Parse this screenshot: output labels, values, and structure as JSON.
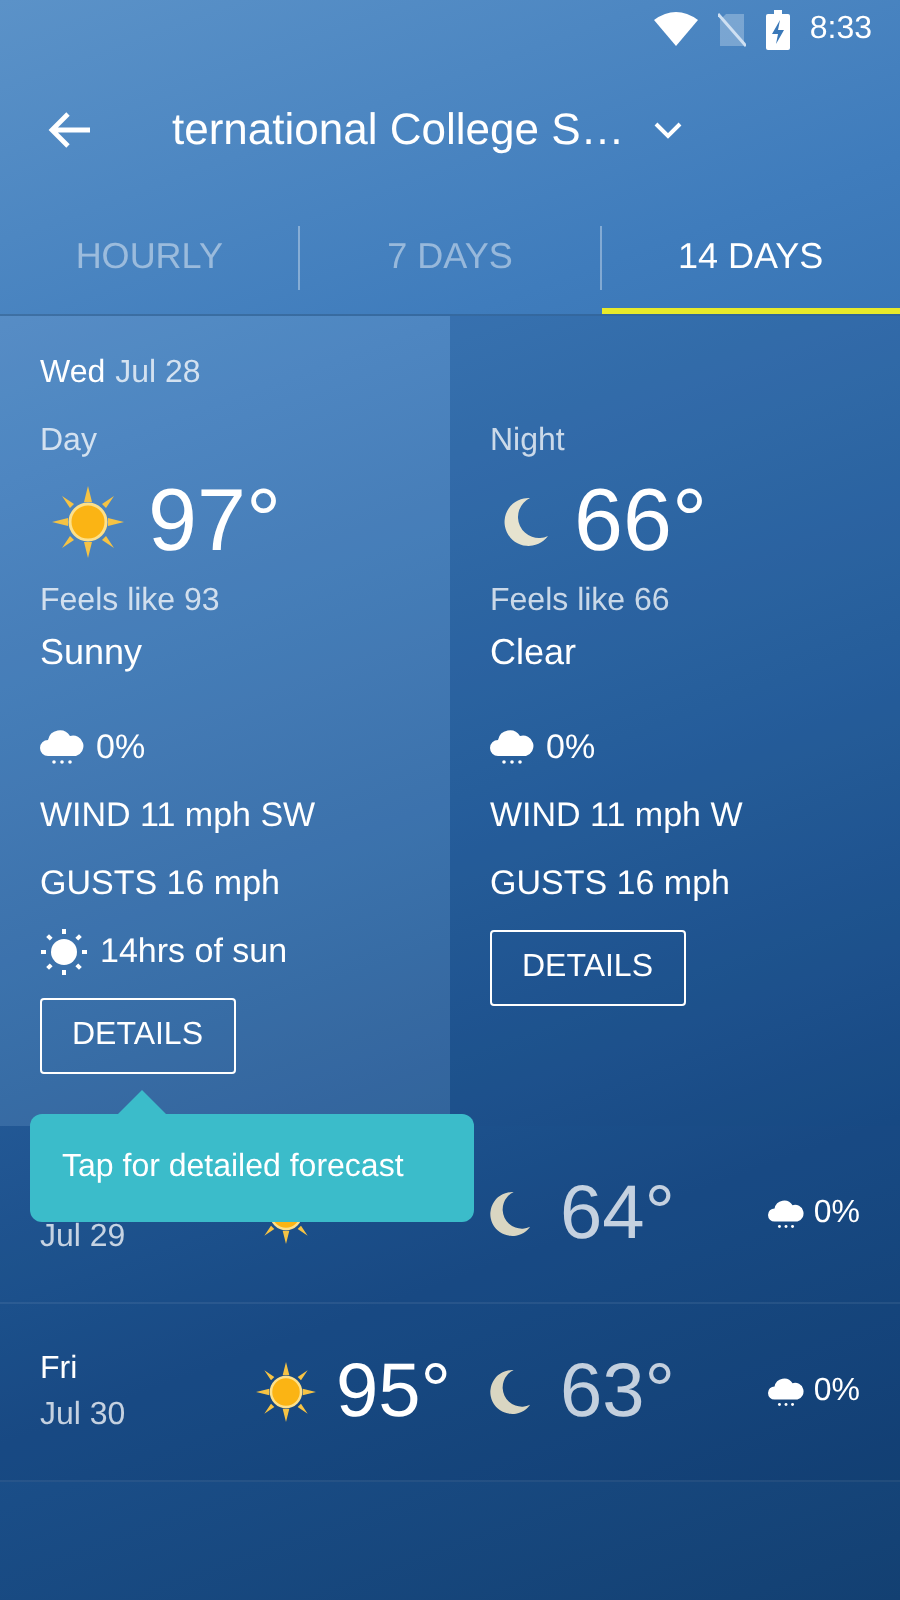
{
  "status_bar": {
    "time": "8:33"
  },
  "header": {
    "title": "ternational College S…"
  },
  "tabs": [
    {
      "label": "HOURLY",
      "selected": false
    },
    {
      "label": "7 DAYS",
      "selected": false
    },
    {
      "label": "14 DAYS",
      "selected": true
    }
  ],
  "detail": {
    "weekday": "Wed",
    "date": "Jul 28",
    "panes": [
      {
        "kind": "day",
        "label": "Day",
        "temp": "97°",
        "feels_like": "Feels like 93",
        "condition": "Sunny",
        "precip": "0%",
        "wind": "WIND 11 mph SW",
        "gusts": "GUSTS 16 mph",
        "sun": "14hrs of sun",
        "button": "DETAILS"
      },
      {
        "kind": "night",
        "label": "Night",
        "temp": "66°",
        "feels_like": "Feels like 66",
        "condition": "Clear",
        "precip": "0%",
        "wind": "WIND 11 mph W",
        "gusts": "GUSTS 16 mph",
        "button": "DETAILS"
      }
    ]
  },
  "tooltip": "Tap for detailed forecast",
  "rows": [
    {
      "date": "Jul 29",
      "night_temp": "64°",
      "precip": "0%"
    },
    {
      "weekday": "Fri",
      "date": "Jul 30",
      "day_temp": "95°",
      "night_temp": "63°",
      "precip": "0%"
    }
  ]
}
